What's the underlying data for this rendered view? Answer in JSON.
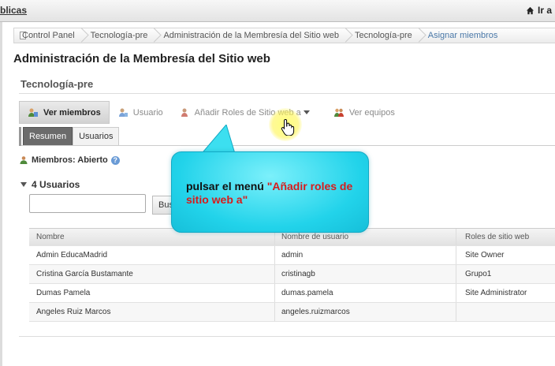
{
  "topbar": {
    "left_text": "blicas",
    "right_text": "Ir a"
  },
  "breadcrumb": [
    "Control Panel",
    "Tecnología-pre",
    "Administración de la Membresía del Sitio web",
    "Tecnología-pre",
    "Asignar miembros"
  ],
  "page_title": "Administración de la Membresía del Sitio web",
  "site_name": "Tecnología-pre",
  "actions": {
    "view_members": "Ver miembros",
    "user": "Usuario",
    "add_site_roles": "Añadir Roles de Sitio web a",
    "view_teams": "Ver equipos"
  },
  "tabs": {
    "summary": "Resumen",
    "users": "Usuarios"
  },
  "members_label": "Miembros: Abierto",
  "users_count": "4 Usuarios",
  "search": {
    "value": "",
    "button": "Bus"
  },
  "table": {
    "headers": [
      "Nombre",
      "Nombre de usuario",
      "Roles de sitio web"
    ],
    "rows": [
      [
        "Admin EducaMadrid",
        "admin",
        "Site Owner"
      ],
      [
        "Cristina García Bustamante",
        "cristinagb",
        "Grupo1"
      ],
      [
        "Dumas Pamela",
        "dumas.pamela",
        "Site Administrator"
      ],
      [
        "Angeles Ruiz Marcos",
        "angeles.ruizmarcos",
        ""
      ]
    ]
  },
  "callout": {
    "text_plain": "pulsar el menú ",
    "text_highlight": "\"Añadir roles de sitio web a\""
  },
  "colors": {
    "callout": "#22d3ea",
    "highlight": "#d81b1b",
    "link": "#4a78a8"
  },
  "icons": [
    "home-icon",
    "user-group-icon",
    "user-icon",
    "add-role-icon",
    "teams-icon",
    "help-icon",
    "hand-cursor-icon"
  ]
}
